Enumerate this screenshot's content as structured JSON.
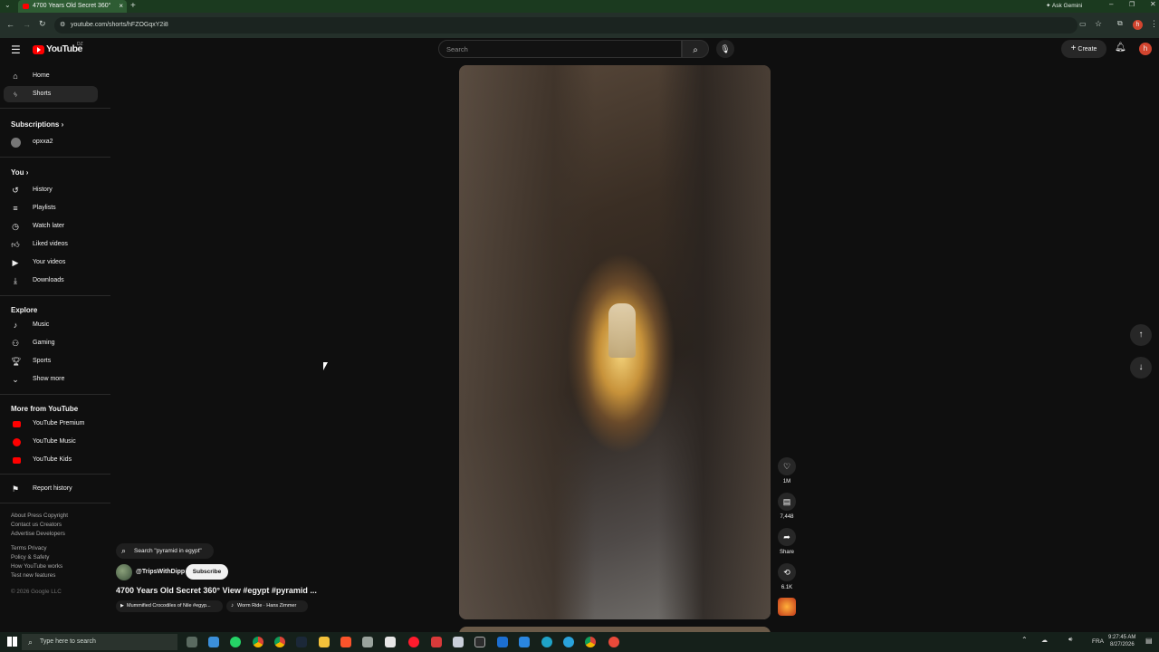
{
  "browser": {
    "tab_title": "4700 Years Old Secret 360°",
    "url": "youtube.com/shorts/hFZOGqxY2i8",
    "ask_gemini": "Ask Gemini",
    "profile_initial": "h"
  },
  "header": {
    "logo_text": "YouTube",
    "logo_region": "DZ",
    "search_placeholder": "Search",
    "create_label": "Create",
    "avatar_initial": "h"
  },
  "sidebar": {
    "top": [
      {
        "label": "Home",
        "icon": "home-icon"
      },
      {
        "label": "Shorts",
        "icon": "shorts-icon"
      }
    ],
    "subscriptions_title": "Subscriptions",
    "subscriptions": [
      {
        "label": "opxxa2"
      }
    ],
    "you_title": "You",
    "you_items": [
      {
        "label": "History",
        "icon": "history-icon"
      },
      {
        "label": "Playlists",
        "icon": "playlists-icon"
      },
      {
        "label": "Watch later",
        "icon": "clock-icon"
      },
      {
        "label": "Liked videos",
        "icon": "thumb-up-icon"
      },
      {
        "label": "Your videos",
        "icon": "video-icon"
      },
      {
        "label": "Downloads",
        "icon": "download-icon"
      }
    ],
    "explore_title": "Explore",
    "explore_items": [
      {
        "label": "Music",
        "icon": "music-icon"
      },
      {
        "label": "Gaming",
        "icon": "gaming-icon"
      },
      {
        "label": "Sports",
        "icon": "trophy-icon"
      },
      {
        "label": "Show more",
        "icon": "chevron-down-icon"
      }
    ],
    "more_title": "More from YouTube",
    "more_items": [
      {
        "label": "YouTube Premium"
      },
      {
        "label": "YouTube Music"
      },
      {
        "label": "YouTube Kids"
      }
    ],
    "report_history": "Report history",
    "footer": [
      "About  Press  Copyright",
      "Contact us  Creators",
      "Advertise  Developers",
      "Terms  Privacy",
      "Policy & Safety",
      "How YouTube works",
      "Test new features",
      "© 2026 Google LLC"
    ]
  },
  "short": {
    "search_chip": "Search \"pyramid in egypt\"",
    "channel": "@TripsWithDipp",
    "subscribe": "Subscribe",
    "title": "4700 Years Old Secret 360° View #egypt #pyramid ...",
    "related": "Mummified Crocodiles of Nile #egyp...",
    "sound": "Worm Ride · Hans Zimmer",
    "likes": "1M",
    "comments": "7,448",
    "share": "Share",
    "remix": "6.1K"
  },
  "taskbar": {
    "search_placeholder": "Type here to search",
    "lang": "FRA",
    "time": "9:27:45 AM",
    "date": "8/27/2026"
  },
  "colors": {
    "accent": "#ff0000",
    "bg": "#0f0f0f",
    "chrome_tab": "#2e5c33"
  }
}
